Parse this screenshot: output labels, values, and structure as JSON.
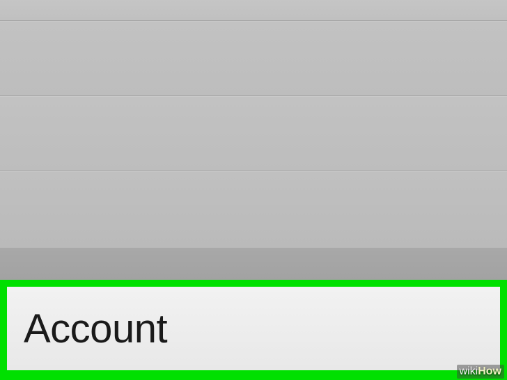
{
  "settings": {
    "account_label": "Account"
  },
  "watermark": {
    "part1": "wiki",
    "part2": "How"
  }
}
